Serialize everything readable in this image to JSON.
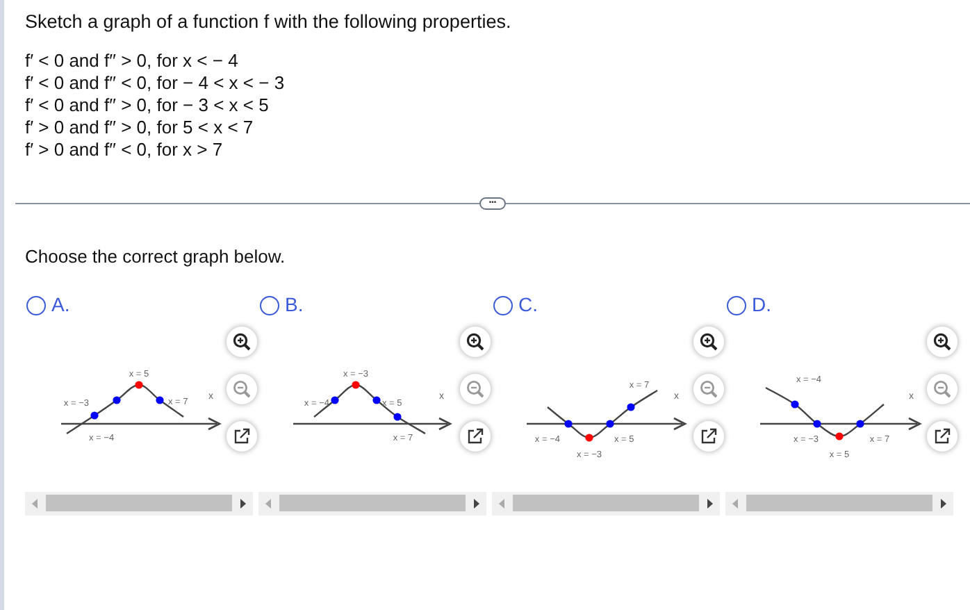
{
  "question": "Sketch a graph of a function f with the following properties.",
  "properties": [
    "f′ < 0 and f′′ > 0, for x <  − 4",
    "f′ < 0 and f′′ < 0, for  − 4 < x <  − 3",
    "f′ < 0 and f′′ > 0, for  − 3 < x < 5",
    "f′ > 0 and f′′ > 0, for 5 < x < 7",
    "f′ > 0 and f′′ < 0, for x > 7"
  ],
  "expand_button": "•••",
  "prompt": "Choose the correct graph below.",
  "options": [
    {
      "label": "A.",
      "selected": false,
      "axis_label": "x",
      "points": [
        {
          "label": "x = −4",
          "color": "#0000ff"
        },
        {
          "label": "x = −3",
          "color": "#0000ff"
        },
        {
          "label": "x = 5",
          "color": "#ff0000"
        },
        {
          "label": "x = 7",
          "color": "#0000ff"
        }
      ]
    },
    {
      "label": "B.",
      "selected": false,
      "axis_label": "x",
      "points": [
        {
          "label": "x = −4",
          "color": "#0000ff"
        },
        {
          "label": "x = −3",
          "color": "#ff0000"
        },
        {
          "label": "x = 5",
          "color": "#0000ff"
        },
        {
          "label": "x = 7",
          "color": "#0000ff"
        }
      ]
    },
    {
      "label": "C.",
      "selected": false,
      "axis_label": "x",
      "points": [
        {
          "label": "x = −4",
          "color": "#0000ff"
        },
        {
          "label": "x = −3",
          "color": "#ff0000"
        },
        {
          "label": "x = 5",
          "color": "#0000ff"
        },
        {
          "label": "x = 7",
          "color": "#0000ff"
        }
      ]
    },
    {
      "label": "D.",
      "selected": false,
      "axis_label": "x",
      "points": [
        {
          "label": "x = −4",
          "color": "#0000ff"
        },
        {
          "label": "x = −3",
          "color": "#0000ff"
        },
        {
          "label": "x = 5",
          "color": "#ff0000"
        },
        {
          "label": "x = 7",
          "color": "#0000ff"
        }
      ]
    }
  ]
}
